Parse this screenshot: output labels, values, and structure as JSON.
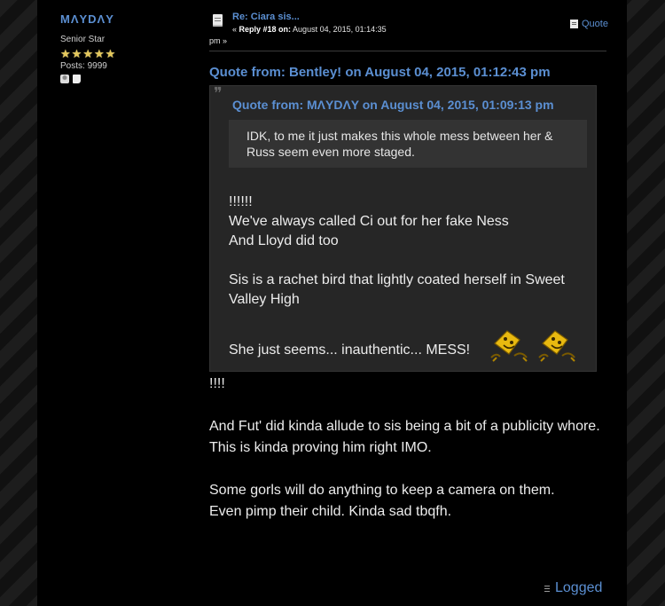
{
  "poster": {
    "name": "MΛYDΛY",
    "group": "Senior Star",
    "stars": [
      "★",
      "★",
      "★",
      "★",
      "★"
    ],
    "posts": "Posts: 9999"
  },
  "post": {
    "subject": "Re: Ciara sis...",
    "reply_prefix": "« ",
    "reply_label": "Reply #18 on:",
    "reply_date": " August 04, 2015, 01:14:35",
    "reply_date_cont": "pm »",
    "quote_button": "Quote"
  },
  "quote_outer": {
    "header": "Quote from: Bentley! on August 04, 2015, 01:12:43 pm",
    "mark": "❞"
  },
  "quote_inner": {
    "header": "Quote from: MΛYDΛY on August 04, 2015, 01:09:13 pm",
    "text": "IDK, to me it just makes this whole mess between her & Russ seem even more staged."
  },
  "quote_outer_body": {
    "lines": [
      "!!!!!!",
      "We've always called Ci out for her fake Ness",
      "And Lloyd did too",
      "",
      "Sis is a rachet bird that lightly coated herself in Sweet Valley High"
    ],
    "last_line": "She just seems... inauthentic... MESS!"
  },
  "body": {
    "line1": "!!!!",
    "line2": "And Fut' did kinda allude to sis being a bit of a publicity whore.",
    "line3": "This is kinda proving him right IMO.",
    "line4": "Some gorls will do anything to keep a camera on them.",
    "line5": "Even pimp their child. Kinda sad tbqfh."
  },
  "footer": {
    "logged": "Logged"
  },
  "colors": {
    "link": "#5b8fd2",
    "star": "#e5c85c",
    "quote_bg": "#262626",
    "inner_quote_bg": "#333333"
  }
}
